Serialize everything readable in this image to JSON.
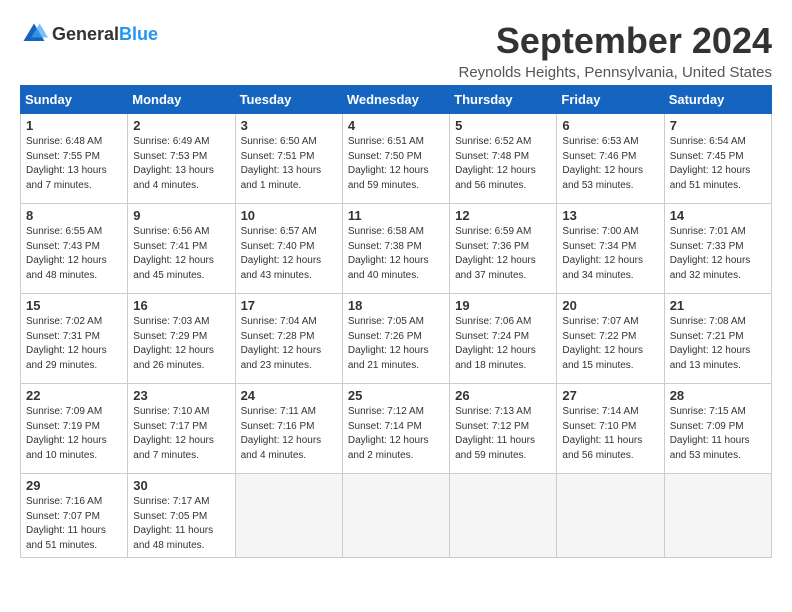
{
  "header": {
    "logo_general": "General",
    "logo_blue": "Blue",
    "title": "September 2024",
    "location": "Reynolds Heights, Pennsylvania, United States"
  },
  "days_of_week": [
    "Sunday",
    "Monday",
    "Tuesday",
    "Wednesday",
    "Thursday",
    "Friday",
    "Saturday"
  ],
  "weeks": [
    [
      {
        "day": "1",
        "detail": "Sunrise: 6:48 AM\nSunset: 7:55 PM\nDaylight: 13 hours\nand 7 minutes."
      },
      {
        "day": "2",
        "detail": "Sunrise: 6:49 AM\nSunset: 7:53 PM\nDaylight: 13 hours\nand 4 minutes."
      },
      {
        "day": "3",
        "detail": "Sunrise: 6:50 AM\nSunset: 7:51 PM\nDaylight: 13 hours\nand 1 minute."
      },
      {
        "day": "4",
        "detail": "Sunrise: 6:51 AM\nSunset: 7:50 PM\nDaylight: 12 hours\nand 59 minutes."
      },
      {
        "day": "5",
        "detail": "Sunrise: 6:52 AM\nSunset: 7:48 PM\nDaylight: 12 hours\nand 56 minutes."
      },
      {
        "day": "6",
        "detail": "Sunrise: 6:53 AM\nSunset: 7:46 PM\nDaylight: 12 hours\nand 53 minutes."
      },
      {
        "day": "7",
        "detail": "Sunrise: 6:54 AM\nSunset: 7:45 PM\nDaylight: 12 hours\nand 51 minutes."
      }
    ],
    [
      {
        "day": "8",
        "detail": "Sunrise: 6:55 AM\nSunset: 7:43 PM\nDaylight: 12 hours\nand 48 minutes."
      },
      {
        "day": "9",
        "detail": "Sunrise: 6:56 AM\nSunset: 7:41 PM\nDaylight: 12 hours\nand 45 minutes."
      },
      {
        "day": "10",
        "detail": "Sunrise: 6:57 AM\nSunset: 7:40 PM\nDaylight: 12 hours\nand 43 minutes."
      },
      {
        "day": "11",
        "detail": "Sunrise: 6:58 AM\nSunset: 7:38 PM\nDaylight: 12 hours\nand 40 minutes."
      },
      {
        "day": "12",
        "detail": "Sunrise: 6:59 AM\nSunset: 7:36 PM\nDaylight: 12 hours\nand 37 minutes."
      },
      {
        "day": "13",
        "detail": "Sunrise: 7:00 AM\nSunset: 7:34 PM\nDaylight: 12 hours\nand 34 minutes."
      },
      {
        "day": "14",
        "detail": "Sunrise: 7:01 AM\nSunset: 7:33 PM\nDaylight: 12 hours\nand 32 minutes."
      }
    ],
    [
      {
        "day": "15",
        "detail": "Sunrise: 7:02 AM\nSunset: 7:31 PM\nDaylight: 12 hours\nand 29 minutes."
      },
      {
        "day": "16",
        "detail": "Sunrise: 7:03 AM\nSunset: 7:29 PM\nDaylight: 12 hours\nand 26 minutes."
      },
      {
        "day": "17",
        "detail": "Sunrise: 7:04 AM\nSunset: 7:28 PM\nDaylight: 12 hours\nand 23 minutes."
      },
      {
        "day": "18",
        "detail": "Sunrise: 7:05 AM\nSunset: 7:26 PM\nDaylight: 12 hours\nand 21 minutes."
      },
      {
        "day": "19",
        "detail": "Sunrise: 7:06 AM\nSunset: 7:24 PM\nDaylight: 12 hours\nand 18 minutes."
      },
      {
        "day": "20",
        "detail": "Sunrise: 7:07 AM\nSunset: 7:22 PM\nDaylight: 12 hours\nand 15 minutes."
      },
      {
        "day": "21",
        "detail": "Sunrise: 7:08 AM\nSunset: 7:21 PM\nDaylight: 12 hours\nand 13 minutes."
      }
    ],
    [
      {
        "day": "22",
        "detail": "Sunrise: 7:09 AM\nSunset: 7:19 PM\nDaylight: 12 hours\nand 10 minutes."
      },
      {
        "day": "23",
        "detail": "Sunrise: 7:10 AM\nSunset: 7:17 PM\nDaylight: 12 hours\nand 7 minutes."
      },
      {
        "day": "24",
        "detail": "Sunrise: 7:11 AM\nSunset: 7:16 PM\nDaylight: 12 hours\nand 4 minutes."
      },
      {
        "day": "25",
        "detail": "Sunrise: 7:12 AM\nSunset: 7:14 PM\nDaylight: 12 hours\nand 2 minutes."
      },
      {
        "day": "26",
        "detail": "Sunrise: 7:13 AM\nSunset: 7:12 PM\nDaylight: 11 hours\nand 59 minutes."
      },
      {
        "day": "27",
        "detail": "Sunrise: 7:14 AM\nSunset: 7:10 PM\nDaylight: 11 hours\nand 56 minutes."
      },
      {
        "day": "28",
        "detail": "Sunrise: 7:15 AM\nSunset: 7:09 PM\nDaylight: 11 hours\nand 53 minutes."
      }
    ],
    [
      {
        "day": "29",
        "detail": "Sunrise: 7:16 AM\nSunset: 7:07 PM\nDaylight: 11 hours\nand 51 minutes."
      },
      {
        "day": "30",
        "detail": "Sunrise: 7:17 AM\nSunset: 7:05 PM\nDaylight: 11 hours\nand 48 minutes."
      },
      {
        "day": "",
        "detail": ""
      },
      {
        "day": "",
        "detail": ""
      },
      {
        "day": "",
        "detail": ""
      },
      {
        "day": "",
        "detail": ""
      },
      {
        "day": "",
        "detail": ""
      }
    ]
  ]
}
